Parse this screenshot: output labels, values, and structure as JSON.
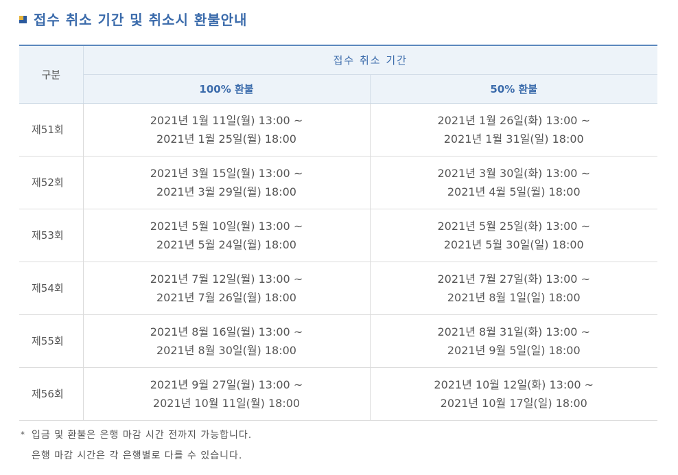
{
  "section": {
    "title": "접수 취소 기간 및 취소시 환불안내"
  },
  "table": {
    "header_gubun": "구분",
    "header_period": "접수 취소 기간",
    "header_100": "100% 환불",
    "header_50": "50% 환불",
    "rows": [
      {
        "round": "제51회",
        "full_start": "2021년 1월 11일(월) 13:00 ~",
        "full_end": "2021년 1월 25일(월) 18:00",
        "half_start": "2021년 1월 26일(화) 13:00 ~",
        "half_end": "2021년 1월 31일(일) 18:00"
      },
      {
        "round": "제52회",
        "full_start": "2021년 3월 15일(월) 13:00 ~",
        "full_end": "2021년 3월 29일(월) 18:00",
        "half_start": "2021년 3월 30일(화) 13:00 ~",
        "half_end": "2021년 4월 5일(월) 18:00"
      },
      {
        "round": "제53회",
        "full_start": "2021년 5월 10일(월) 13:00 ~",
        "full_end": "2021년 5월 24일(월) 18:00",
        "half_start": "2021년 5월 25일(화) 13:00 ~",
        "half_end": "2021년 5월 30일(일) 18:00"
      },
      {
        "round": "제54회",
        "full_start": "2021년 7월 12일(월) 13:00 ~",
        "full_end": "2021년 7월 26일(월) 18:00",
        "half_start": "2021년 7월 27일(화) 13:00 ~",
        "half_end": "2021년 8월 1일(일) 18:00"
      },
      {
        "round": "제55회",
        "full_start": "2021년 8월 16일(월) 13:00 ~",
        "full_end": "2021년 8월 30일(월) 18:00",
        "half_start": "2021년 8월 31일(화) 13:00 ~",
        "half_end": "2021년 9월 5일(일) 18:00"
      },
      {
        "round": "제56회",
        "full_start": "2021년 9월 27일(월) 13:00 ~",
        "full_end": "2021년 10월 11일(월) 18:00",
        "half_start": "2021년 10월 12일(화) 13:00 ~",
        "half_end": "2021년 10월 17일(일) 18:00"
      }
    ]
  },
  "notes": {
    "mark": "*",
    "line1": "입금 및 환불은 은행 마감 시간 전까지 가능합니다.",
    "line2": "은행 마감 시간은 각 은행별로 다를 수 있습니다."
  },
  "colors": {
    "title": "#3b6bab",
    "bullet_accent": "#e5b43c",
    "header_bg": "#edf3f9",
    "header_border": "#5b87bd"
  }
}
